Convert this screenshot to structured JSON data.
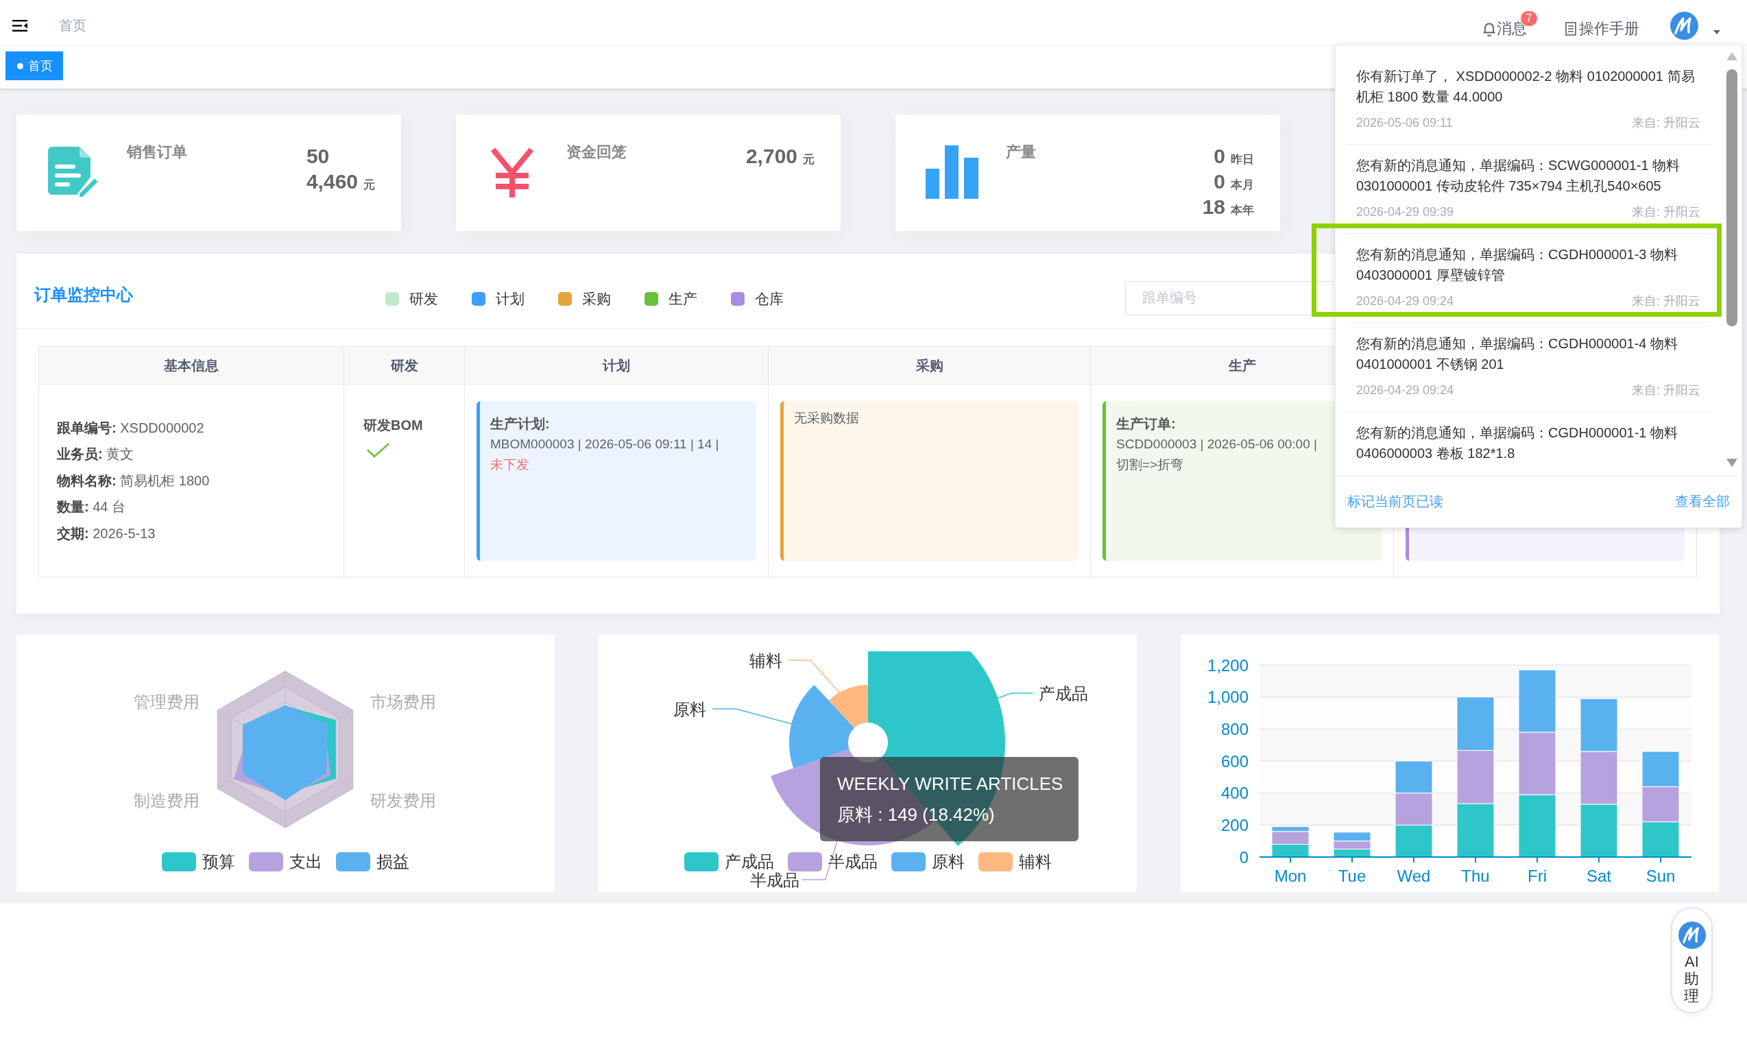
{
  "header": {
    "breadcrumb": "首页",
    "messages": {
      "label": "消息",
      "badge": "7"
    },
    "manual": {
      "label": "操作手册"
    }
  },
  "tags": [
    {
      "label": "首页",
      "selected": true
    }
  ],
  "stats": [
    {
      "kind": "orders",
      "title": "销售订单",
      "values": [
        {
          "value": "50"
        },
        {
          "value": "4,460",
          "unit": "元"
        }
      ]
    },
    {
      "kind": "money",
      "title": "资金回笼",
      "values": [
        {
          "value": "2,700",
          "unit": "元"
        }
      ]
    },
    {
      "kind": "output",
      "title": "产量",
      "values": [
        {
          "value": "0",
          "unit": "昨日"
        },
        {
          "value": "0",
          "unit": "本月"
        },
        {
          "value": "18",
          "unit": "本年"
        }
      ]
    }
  ],
  "monitor": {
    "title": "订单监控中心",
    "legend": [
      {
        "label": "研发",
        "color": "#c4e8cd"
      },
      {
        "label": "计划",
        "color": "#409eff"
      },
      {
        "label": "采购",
        "color": "#e6a23c"
      },
      {
        "label": "生产",
        "color": "#67c23a"
      },
      {
        "label": "仓库",
        "color": "#a88ee0"
      }
    ],
    "search": {
      "placeholder": "跟单编号"
    },
    "table": {
      "columns": [
        "基本信息",
        "研发",
        "计划",
        "采购",
        "生产"
      ],
      "row": {
        "info": [
          {
            "label": "跟单编号:",
            "value": "XSDD000002"
          },
          {
            "label": "业务员:",
            "value": "黄文"
          },
          {
            "label": "物料名称:",
            "value": "简易机柜 1800"
          },
          {
            "label": "数量:",
            "value": "44 台"
          },
          {
            "label": "交期:",
            "value": "2026-5-13"
          }
        ],
        "rd": {
          "label": "研发BOM",
          "done": true
        },
        "stages": [
          {
            "kind": "record",
            "color": "#409eff",
            "title": "生产计划:",
            "detail": "MBOM000003 | 2026-05-06 09:11 | 14 |",
            "status": "未下发"
          },
          {
            "kind": "empty",
            "color": "#e6a23c",
            "text": "无采购数据"
          },
          {
            "kind": "record",
            "color": "#67c23a",
            "title": "生产订单:",
            "detail": "SCDD000003 | 2026-05-06 00:00 |",
            "note": "切割=>折弯"
          },
          {
            "kind": "record",
            "color": "#a88ee0"
          }
        ]
      }
    }
  },
  "radar": {
    "axes": [
      "管理费用",
      "市场费用",
      "制造费用",
      "研发费用"
    ],
    "legend": [
      {
        "label": "预算",
        "color": "#2ec7c9"
      },
      {
        "label": "支出",
        "color": "#b6a2de"
      },
      {
        "label": "损益",
        "color": "#5ab1ef"
      }
    ]
  },
  "rose": {
    "labels": [
      "产成品",
      "半成品",
      "原料",
      "辅料"
    ],
    "tooltip": {
      "title": "WEEKLY WRITE ARTICLES",
      "text": "原料 : 149 (18.42%)"
    },
    "legend": [
      {
        "label": "产成品",
        "color": "#2ec7c9"
      },
      {
        "label": "半成品",
        "color": "#b6a2de"
      },
      {
        "label": "原料",
        "color": "#5ab1ef"
      },
      {
        "label": "辅料",
        "color": "#ffb980"
      }
    ]
  },
  "bar": {
    "chart_data": {
      "type": "bar",
      "stacked": true,
      "grid": true,
      "categories": [
        "Mon",
        "Tue",
        "Wed",
        "Thu",
        "Fri",
        "Sat",
        "Sun"
      ],
      "series": [
        {
          "color": "#2ec7c9",
          "values": [
            80,
            50,
            200,
            334,
            390,
            330,
            220
          ]
        },
        {
          "color": "#b6a2de",
          "values": [
            80,
            50,
            200,
            333,
            390,
            330,
            220
          ]
        },
        {
          "color": "#5ab1ef",
          "values": [
            30,
            55,
            200,
            333,
            390,
            330,
            220
          ]
        }
      ],
      "ylim": [
        0,
        1200
      ],
      "yticks": [
        0,
        200,
        400,
        600,
        800,
        {
          "value": 1000,
          "label": "1,000"
        },
        {
          "value": 1200,
          "label": "1,200"
        }
      ]
    }
  },
  "notifications": {
    "items": [
      {
        "text": "你有新订单了， XSDD000002-2 物料 0102000001 简易机柜 1800 数量 44.0000",
        "time": "2026-05-06 09:11",
        "source": "来自: 升阳云",
        "highlighted": false
      },
      {
        "text": "您有新的消息通知，单据编码：SCWG000001-1 物料 0301000001 传动皮轮件 735×794 主机孔540×605",
        "time": "2026-04-29 09:39",
        "source": "来自: 升阳云",
        "highlighted": false
      },
      {
        "text": "您有新的消息通知，单据编码：CGDH000001-3 物料 0403000001 厚壁镀锌管",
        "time": "2026-04-29 09:24",
        "source": "来自: 升阳云",
        "highlighted": true
      },
      {
        "text": "您有新的消息通知，单据编码：CGDH000001-4 物料 0401000001 不锈钢 201",
        "time": "2026-04-29 09:24",
        "source": "来自: 升阳云",
        "highlighted": false
      },
      {
        "text": "您有新的消息通知，单据编码：CGDH000001-1 物料 0406000003 卷板 182*1.8",
        "highlighted": false
      }
    ],
    "mark_read": "标记当前页已读",
    "view_all": "查看全部"
  },
  "assistant": {
    "label": "AI助理"
  }
}
